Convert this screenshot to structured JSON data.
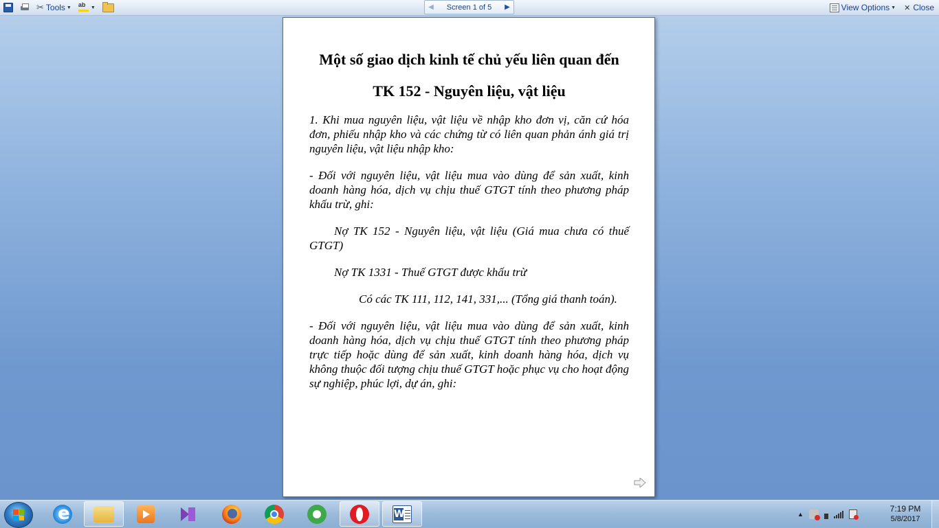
{
  "toolbar": {
    "tools_label": "Tools",
    "screen_label": "Screen 1 of 5",
    "view_options_label": "View Options",
    "close_label": "Close"
  },
  "document": {
    "title_line1": "Một số giao dịch kinh tế chủ yếu liên quan đến",
    "title_line2": "TK 152 - Nguyên liệu, vật liệu",
    "paragraphs": [
      "1. Khi mua nguyên liệu, vật liệu về nhập kho đơn vị, căn cứ hóa đơn, phiếu nhập kho và các chứng từ có liên quan phản ánh giá trị nguyên liệu, vật liệu nhập kho:",
      "- Đối với nguyên liệu, vật liệu mua vào dùng để sản xuất, kinh doanh hàng hóa, dịch vụ chịu thuế GTGT tính theo phương pháp khấu trừ, ghi:",
      "Nợ TK 152 - Nguyên liệu, vật liệu (Giá mua chưa có thuế GTGT)",
      "Nợ TK 1331 - Thuế GTGT được khấu trừ",
      "Có các TK 111, 112, 141, 331,... (Tổng giá thanh toán).",
      "- Đối với nguyên liệu, vật liệu mua vào dùng để sản xuất, kinh doanh hàng hóa, dịch vụ chịu thuế GTGT tính theo phương pháp trực tiếp hoặc dùng để sản xuất, kinh doanh hàng hóa, dịch vụ không thuộc đối tượng chịu thuế GTGT hoặc phục vụ cho hoạt động sự nghiệp, phúc lợi, dự án, ghi:"
    ]
  },
  "taskbar": {
    "time": "7:19 PM",
    "date": "5/8/2017",
    "apps": [
      "internet-explorer",
      "windows-explorer",
      "media-center",
      "visual-studio",
      "firefox",
      "chrome",
      "coc-coc",
      "opera",
      "word"
    ]
  }
}
